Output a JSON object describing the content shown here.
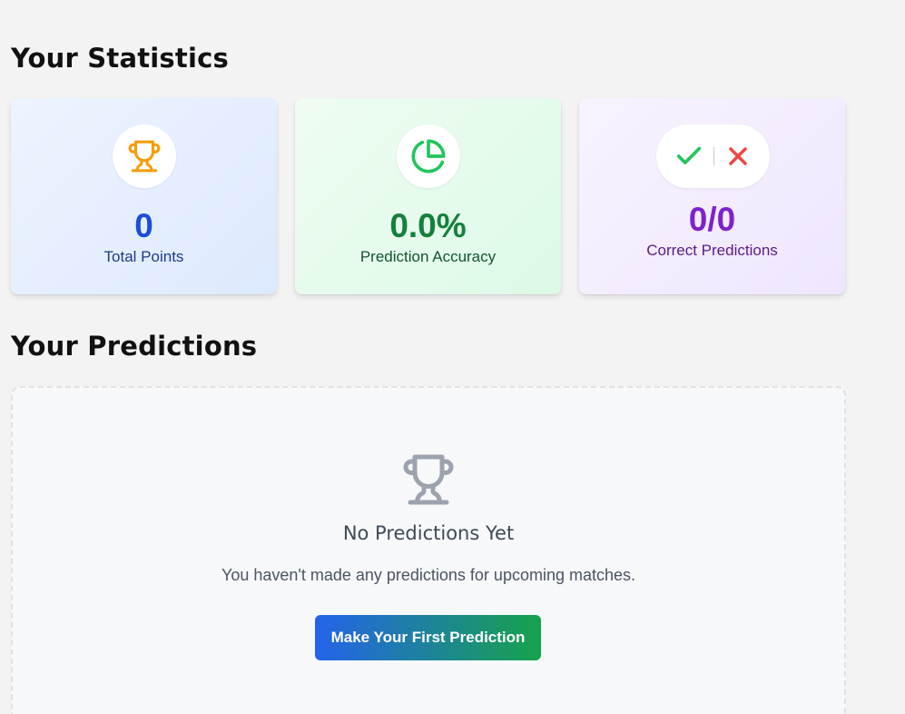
{
  "statistics": {
    "title": "Your Statistics",
    "cards": [
      {
        "value": "0",
        "label": "Total Points",
        "icon": "trophy-icon",
        "accent": "#f59e0b"
      },
      {
        "value": "0.0%",
        "label": "Prediction Accuracy",
        "icon": "pie-chart-icon",
        "accent": "#22c55e"
      },
      {
        "value": "0/0",
        "label": "Correct Predictions",
        "icons": [
          "check-icon",
          "x-icon"
        ],
        "accents": [
          "#22c55e",
          "#ef4444"
        ]
      }
    ]
  },
  "predictions": {
    "title": "Your Predictions",
    "empty_state": {
      "icon": "trophy-icon",
      "title": "No Predictions Yet",
      "message": "You haven't made any predictions for upcoming matches.",
      "button_label": "Make Your First Prediction"
    }
  },
  "colors": {
    "blue": "#1d4ed8",
    "green": "#15803d",
    "purple": "#7e22ce",
    "gradient_start": "#2563eb",
    "gradient_end": "#16a34a"
  }
}
